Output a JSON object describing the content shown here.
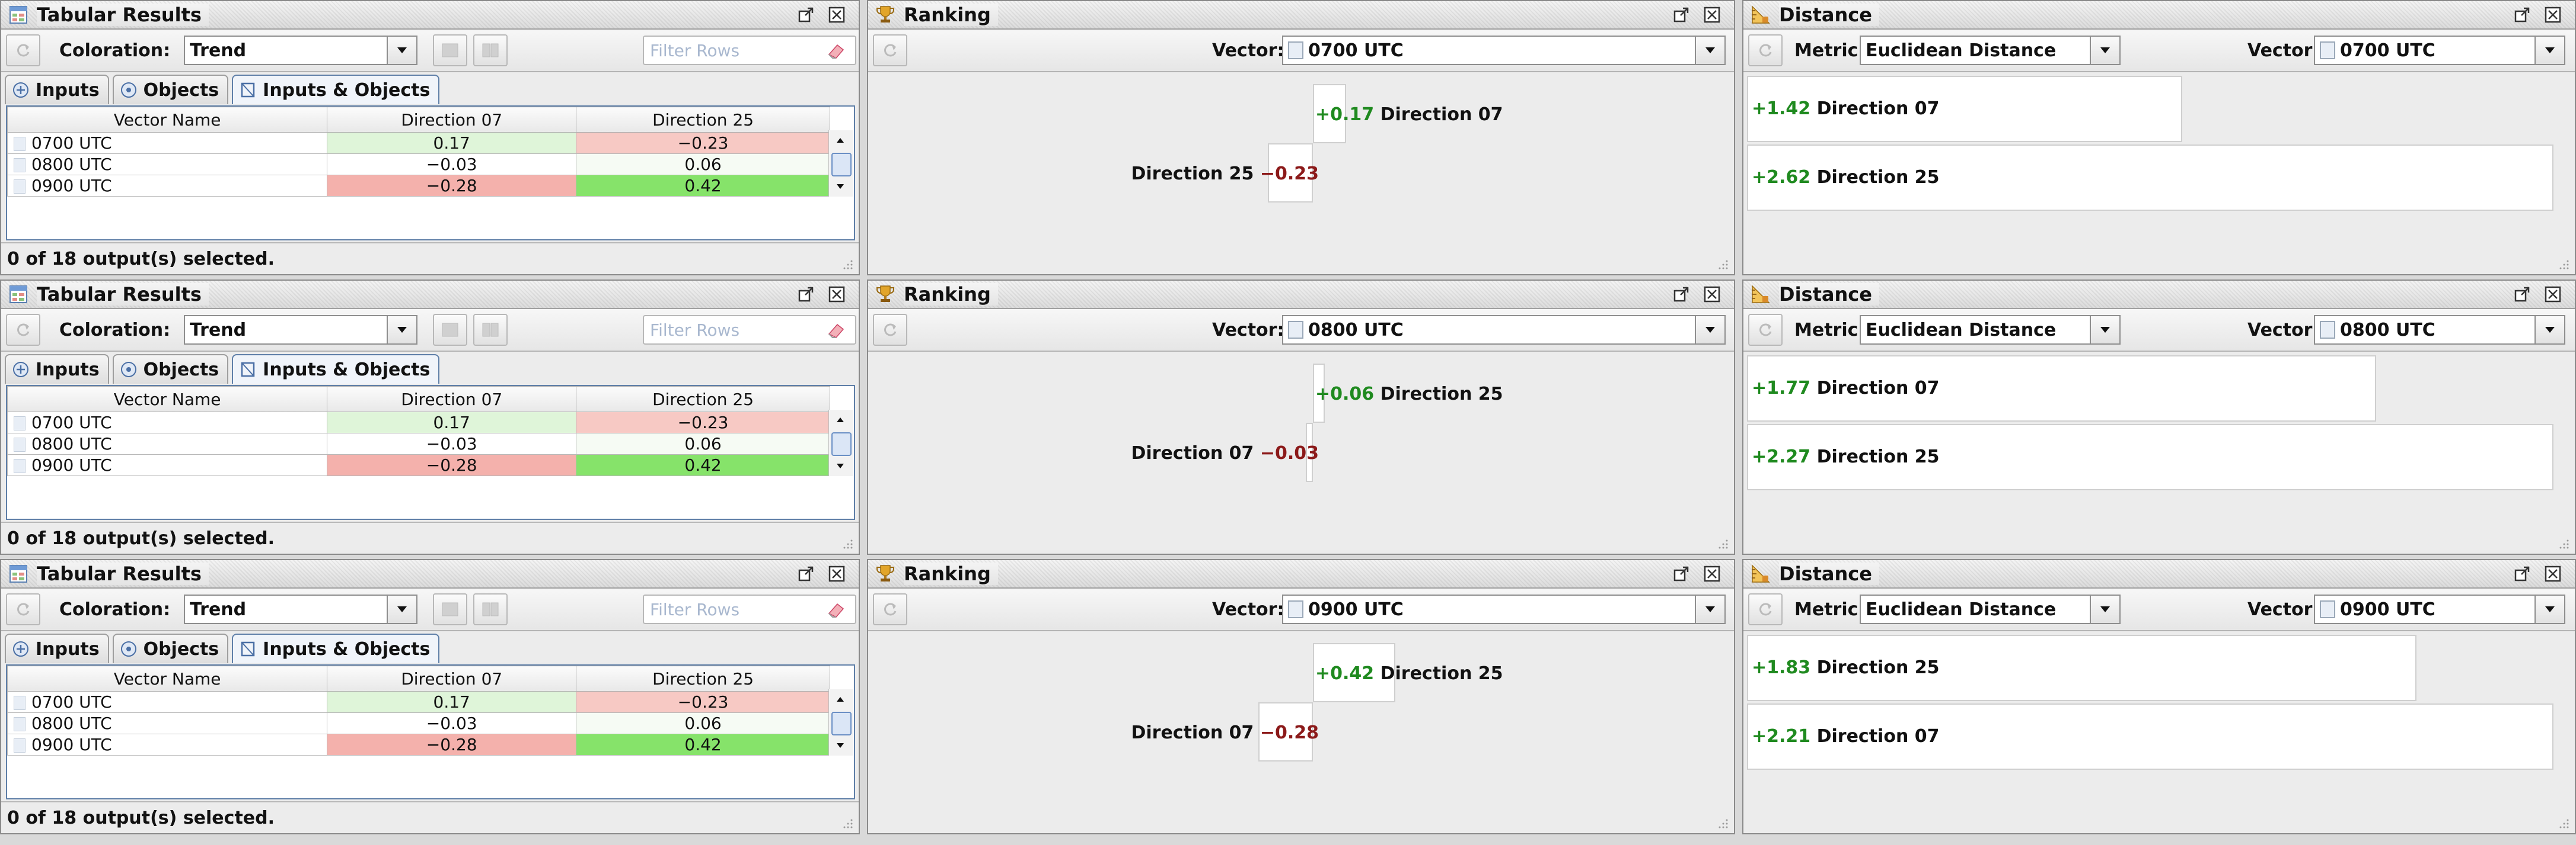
{
  "colors": {
    "positive": "#1f8a1f",
    "negative": "#8c1a1a",
    "cell_green_light": "#dff5d9",
    "cell_green": "#86e36a",
    "cell_red": "#f4b1ac",
    "cell_red_light": "#f7c9c4"
  },
  "icons": {
    "tabular": "table-icon",
    "ranking": "trophy-icon",
    "distance": "ruler-icon"
  },
  "bands": [
    {
      "tabular": {
        "title": "Tabular Results",
        "coloration_label": "Coloration:",
        "coloration_value": "Trend",
        "filter_placeholder": "Filter Rows",
        "tabs": [
          "Inputs",
          "Objects",
          "Inputs & Objects"
        ],
        "columns": [
          "Vector Name",
          "Direction 07",
          "Direction 25"
        ],
        "rows": [
          [
            "0700 UTC",
            "0.17",
            "−0.23"
          ],
          [
            "0800 UTC",
            "−0.03",
            "0.06"
          ],
          [
            "0900 UTC",
            "−0.28",
            "0.42"
          ]
        ],
        "status": "0 of 18 output(s) selected."
      },
      "ranking": {
        "title": "Ranking",
        "vector_label": "Vector:",
        "vector_value": "0700 UTC",
        "top": {
          "value": "+0.17",
          "name": "Direction 07",
          "fraction": 0.17
        },
        "bottom": {
          "value": "−0.23",
          "name": "Direction 25",
          "fraction": 0.23
        }
      },
      "distance": {
        "title": "Distance",
        "metric_label": "Metric:",
        "metric_value": "Euclidean Distance",
        "vector_label": "Vector:",
        "vector_value": "0700 UTC",
        "items": [
          {
            "value": "+1.42",
            "name": "Direction 07",
            "fraction": 0.54
          },
          {
            "value": "+2.62",
            "name": "Direction 25",
            "fraction": 1.0
          }
        ]
      }
    },
    {
      "tabular": {
        "title": "Tabular Results",
        "coloration_label": "Coloration:",
        "coloration_value": "Trend",
        "filter_placeholder": "Filter Rows",
        "tabs": [
          "Inputs",
          "Objects",
          "Inputs & Objects"
        ],
        "columns": [
          "Vector Name",
          "Direction 07",
          "Direction 25"
        ],
        "rows": [
          [
            "0700 UTC",
            "0.17",
            "−0.23"
          ],
          [
            "0800 UTC",
            "−0.03",
            "0.06"
          ],
          [
            "0900 UTC",
            "−0.28",
            "0.42"
          ]
        ],
        "status": "0 of 18 output(s) selected."
      },
      "ranking": {
        "title": "Ranking",
        "vector_label": "Vector:",
        "vector_value": "0800 UTC",
        "top": {
          "value": "+0.06",
          "name": "Direction 25",
          "fraction": 0.06
        },
        "bottom": {
          "value": "−0.03",
          "name": "Direction 07",
          "fraction": 0.03
        }
      },
      "distance": {
        "title": "Distance",
        "metric_label": "Metric:",
        "metric_value": "Euclidean Distance",
        "vector_label": "Vector:",
        "vector_value": "0800 UTC",
        "items": [
          {
            "value": "+1.77",
            "name": "Direction 07",
            "fraction": 0.78
          },
          {
            "value": "+2.27",
            "name": "Direction 25",
            "fraction": 1.0
          }
        ]
      }
    },
    {
      "tabular": {
        "title": "Tabular Results",
        "coloration_label": "Coloration:",
        "coloration_value": "Trend",
        "filter_placeholder": "Filter Rows",
        "tabs": [
          "Inputs",
          "Objects",
          "Inputs & Objects"
        ],
        "columns": [
          "Vector Name",
          "Direction 07",
          "Direction 25"
        ],
        "rows": [
          [
            "0700 UTC",
            "0.17",
            "−0.23"
          ],
          [
            "0800 UTC",
            "−0.03",
            "0.06"
          ],
          [
            "0900 UTC",
            "−0.28",
            "0.42"
          ]
        ],
        "status": "0 of 18 output(s) selected."
      },
      "ranking": {
        "title": "Ranking",
        "vector_label": "Vector:",
        "vector_value": "0900 UTC",
        "top": {
          "value": "+0.42",
          "name": "Direction 25",
          "fraction": 0.42
        },
        "bottom": {
          "value": "−0.28",
          "name": "Direction 07",
          "fraction": 0.28
        }
      },
      "distance": {
        "title": "Distance",
        "metric_label": "Metric:",
        "metric_value": "Euclidean Distance",
        "vector_label": "Vector:",
        "vector_value": "0900 UTC",
        "items": [
          {
            "value": "+1.83",
            "name": "Direction 25",
            "fraction": 0.83
          },
          {
            "value": "+2.21",
            "name": "Direction 07",
            "fraction": 1.0
          }
        ]
      }
    }
  ]
}
